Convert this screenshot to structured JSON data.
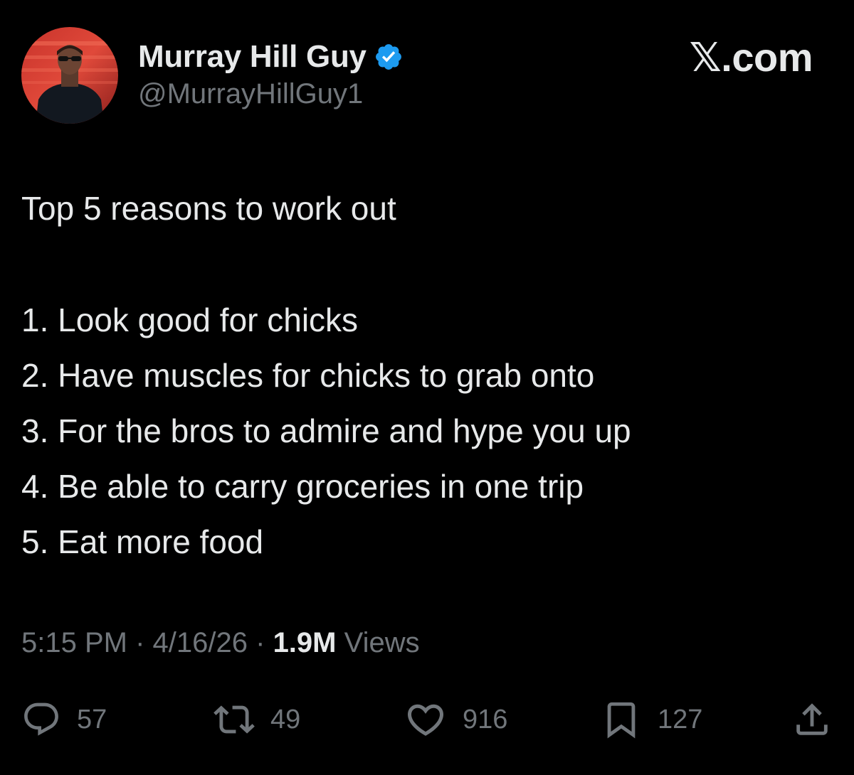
{
  "author": {
    "display_name": "Murray Hill Guy",
    "handle": "@MurrayHillGuy1",
    "verified": true,
    "verified_color": "#1d9bf0"
  },
  "brand": {
    "label": "𝕏.com"
  },
  "tweet": {
    "title_line": "Top 5 reasons to work out",
    "list": [
      "1. Look good for chicks",
      "2. Have muscles for chicks to grab onto",
      "3. For the bros to admire and hype you up",
      "4. Be able to carry groceries in one trip",
      "5. Eat more food"
    ]
  },
  "meta": {
    "time": "5:15 PM",
    "separator": "·",
    "date": "4/16/26",
    "views_count": "1.9M",
    "views_label": "Views"
  },
  "actions": {
    "reply": {
      "icon": "reply-icon",
      "count": "57"
    },
    "repost": {
      "icon": "repost-icon",
      "count": "49"
    },
    "like": {
      "icon": "heart-icon",
      "count": "916"
    },
    "bookmark": {
      "icon": "bookmark-icon",
      "count": "127"
    },
    "share": {
      "icon": "share-icon"
    }
  },
  "colors": {
    "background": "#000000",
    "text_primary": "#e7e9ea",
    "text_secondary": "#71767b",
    "accent": "#1d9bf0"
  }
}
